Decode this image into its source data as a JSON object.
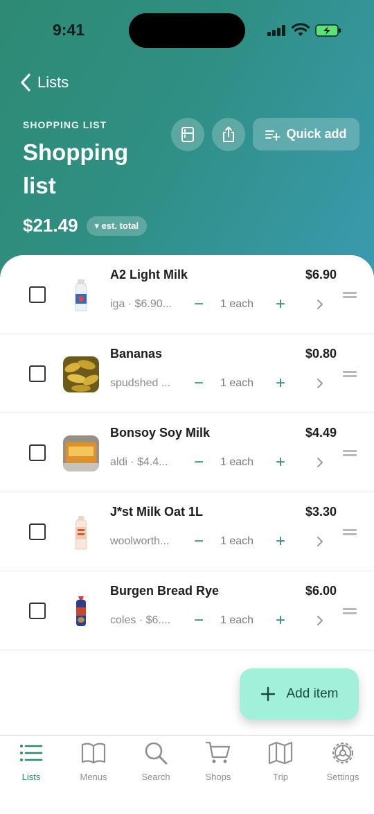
{
  "status_bar": {
    "time": "9:41"
  },
  "nav": {
    "back_label": "Lists"
  },
  "list": {
    "kicker": "SHOPPING LIST",
    "title": "Shopping list",
    "total": "$21.49",
    "total_badge": "▾ est. total"
  },
  "actions": {
    "quick_add_label": "Quick add"
  },
  "items": [
    {
      "name": "A2 Light Milk",
      "price": "$6.90",
      "sub": "iga · $6.90...",
      "qty": "1 each"
    },
    {
      "name": "Bananas",
      "price": "$0.80",
      "sub": "spudshed ...",
      "qty": "1 each"
    },
    {
      "name": "Bonsoy Soy Milk",
      "price": "$4.49",
      "sub": "aldi · $4.4...",
      "qty": "1 each"
    },
    {
      "name": "J*st Milk Oat 1L",
      "price": "$3.30",
      "sub": "woolworth...",
      "qty": "1 each"
    },
    {
      "name": "Burgen Bread Rye",
      "price": "$6.00",
      "sub": "coles · $6....",
      "qty": "1 each"
    }
  ],
  "fab": {
    "label": "Add item",
    "icon": "+"
  },
  "tabs": [
    {
      "label": "Lists",
      "icon": "list-icon",
      "active": true
    },
    {
      "label": "Menus",
      "icon": "book-icon",
      "active": false
    },
    {
      "label": "Search",
      "icon": "search-icon",
      "active": false
    },
    {
      "label": "Shops",
      "icon": "cart-icon",
      "active": false
    },
    {
      "label": "Trip",
      "icon": "map-icon",
      "active": false
    },
    {
      "label": "Settings",
      "icon": "gear-icon",
      "active": false
    }
  ],
  "colors": {
    "accent": "#2a8a74",
    "header_start": "#2e8a73",
    "header_end": "#3a9bb0",
    "fab": "#a3f0da"
  }
}
